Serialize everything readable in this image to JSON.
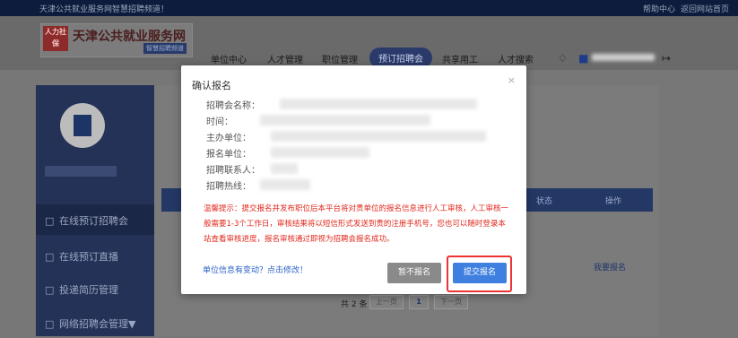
{
  "topbar": {
    "welcome": "天津公共就业服务网智慧招聘频道！",
    "help": "帮助中心",
    "back_home": "返回网站首页"
  },
  "header": {
    "logo_badge": "人力社保",
    "logo_name": "天津公共就业服务网",
    "logo_tag": "智慧招聘频道",
    "nav": [
      "单位中心",
      "人才管理",
      "职位管理",
      "预订招聘会",
      "共享用工",
      "人才搜索"
    ]
  },
  "sidebar": {
    "items": [
      {
        "label": "在线预订招聘会",
        "icon": "calendar-icon"
      },
      {
        "label": "在线预订直播",
        "icon": "calendar-icon"
      },
      {
        "label": "投递简历管理",
        "icon": "folder-icon"
      },
      {
        "label": "网络招聘会管理▼",
        "icon": "folder-icon"
      }
    ]
  },
  "content": {
    "table_headers": {
      "status": "状态",
      "action": "操作"
    },
    "row_action": "我要报名",
    "pager": {
      "total": "共 2 条",
      "prev": "上一页",
      "page": "1",
      "next": "下一页"
    }
  },
  "modal": {
    "title": "确认报名",
    "close": "×",
    "fields": [
      {
        "label": "招聘会名称："
      },
      {
        "label": "时间："
      },
      {
        "label": "主办单位："
      },
      {
        "label": "报名单位："
      },
      {
        "label": "招聘联系人："
      },
      {
        "label": "招聘热线："
      }
    ],
    "notice": "温馨提示：提交报名并发布职位后本平台将对贵单位的报名信息进行人工审核，人工审核一般需要1-3个工作日，审核结果将以短信形式发送到贵的注册手机号，您也可以随时登录本站查看审核进度，报名审核通过即视为招聘会报名成功。",
    "change_link": "单位信息有变动？点击修改！",
    "cancel_button": "暂不报名",
    "submit_button": "提交报名"
  },
  "colors": {
    "accent": "#3f7fe0",
    "notice": "#e0281c",
    "highlight_border": "#ee3333"
  }
}
